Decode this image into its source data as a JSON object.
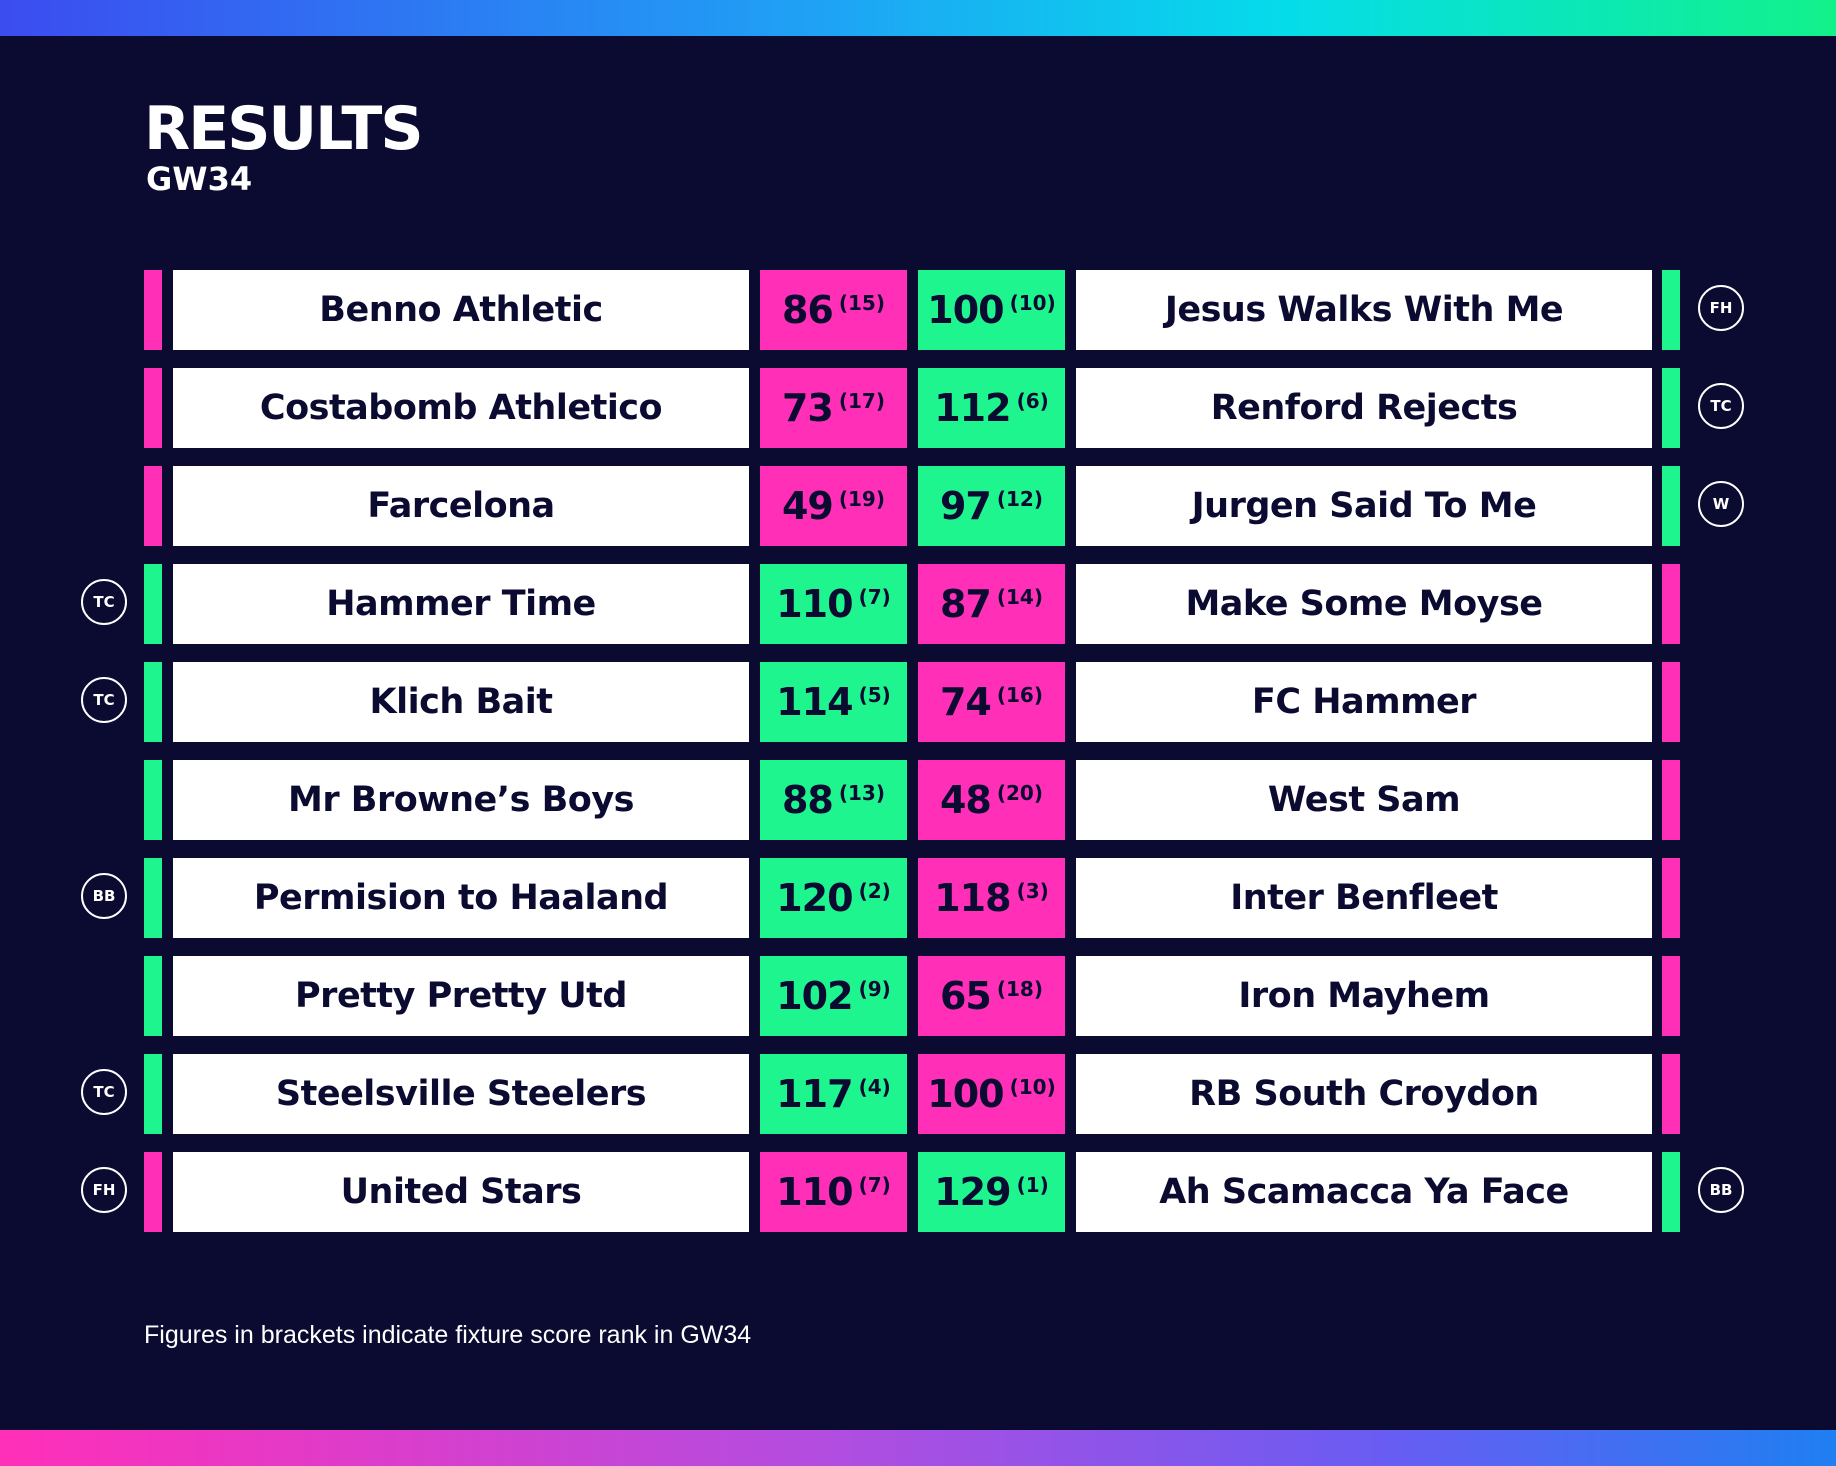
{
  "header": {
    "title": "RESULTS",
    "subtitle": "GW34"
  },
  "colors": {
    "win": "#1ff58e",
    "loss": "#ff2fb8",
    "background": "#0b0a30"
  },
  "fixtures": [
    {
      "home": {
        "name": "Benno Athletic",
        "score": "86",
        "rank": "(15)",
        "result": "loss",
        "chip": ""
      },
      "away": {
        "name": "Jesus Walks With Me",
        "score": "100",
        "rank": "(10)",
        "result": "win",
        "chip": "FH"
      }
    },
    {
      "home": {
        "name": "Costabomb Athletico",
        "score": "73",
        "rank": "(17)",
        "result": "loss",
        "chip": ""
      },
      "away": {
        "name": "Renford Rejects",
        "score": "112",
        "rank": "(6)",
        "result": "win",
        "chip": "TC"
      }
    },
    {
      "home": {
        "name": "Farcelona",
        "score": "49",
        "rank": "(19)",
        "result": "loss",
        "chip": ""
      },
      "away": {
        "name": "Jurgen Said To Me",
        "score": "97",
        "rank": "(12)",
        "result": "win",
        "chip": "W"
      }
    },
    {
      "home": {
        "name": "Hammer Time",
        "score": "110",
        "rank": "(7)",
        "result": "win",
        "chip": "TC"
      },
      "away": {
        "name": "Make Some Moyse",
        "score": "87",
        "rank": "(14)",
        "result": "loss",
        "chip": ""
      }
    },
    {
      "home": {
        "name": "Klich Bait",
        "score": "114",
        "rank": "(5)",
        "result": "win",
        "chip": "TC"
      },
      "away": {
        "name": "FC Hammer",
        "score": "74",
        "rank": "(16)",
        "result": "loss",
        "chip": ""
      }
    },
    {
      "home": {
        "name": "Mr Browne’s Boys",
        "score": "88",
        "rank": "(13)",
        "result": "win",
        "chip": ""
      },
      "away": {
        "name": "West Sam",
        "score": "48",
        "rank": "(20)",
        "result": "loss",
        "chip": ""
      }
    },
    {
      "home": {
        "name": "Permision to Haaland",
        "score": "120",
        "rank": "(2)",
        "result": "win",
        "chip": "BB"
      },
      "away": {
        "name": "Inter Benfleet",
        "score": "118",
        "rank": "(3)",
        "result": "loss",
        "chip": ""
      }
    },
    {
      "home": {
        "name": "Pretty Pretty Utd",
        "score": "102",
        "rank": "(9)",
        "result": "win",
        "chip": ""
      },
      "away": {
        "name": "Iron Mayhem",
        "score": "65",
        "rank": "(18)",
        "result": "loss",
        "chip": ""
      }
    },
    {
      "home": {
        "name": "Steelsville Steelers",
        "score": "117",
        "rank": "(4)",
        "result": "win",
        "chip": "TC"
      },
      "away": {
        "name": "RB South Croydon",
        "score": "100",
        "rank": "(10)",
        "result": "loss",
        "chip": ""
      }
    },
    {
      "home": {
        "name": "United Stars",
        "score": "110",
        "rank": "(7)",
        "result": "loss",
        "chip": "FH"
      },
      "away": {
        "name": "Ah Scamacca Ya Face",
        "score": "129",
        "rank": "(1)",
        "result": "win",
        "chip": "BB"
      }
    }
  ],
  "footnote": "Figures in brackets indicate fixture score rank in GW34"
}
